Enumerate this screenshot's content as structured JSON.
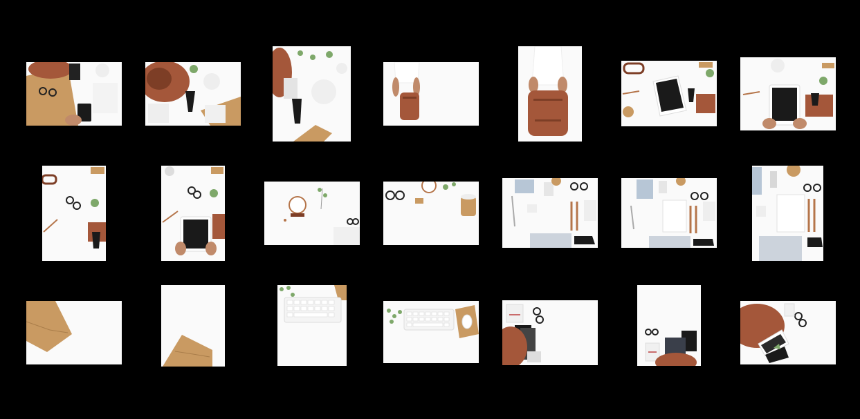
{
  "background_color": "#000000",
  "gallery": {
    "rows": [
      {
        "items": [
          {
            "subject": "leather-bag-phone-glasses"
          },
          {
            "subject": "leather-bag-tassel-notebook"
          },
          {
            "subject": "leather-bag-tassel-flowers"
          },
          {
            "subject": "woman-holding-backpack-wide"
          },
          {
            "subject": "woman-holding-backpack-tall"
          },
          {
            "subject": "tablet-wallet-flatlay"
          },
          {
            "subject": "hands-holding-tablet"
          }
        ]
      },
      {
        "items": [
          {
            "subject": "desk-glasses-pencils"
          },
          {
            "subject": "hands-holding-tablet-tall"
          },
          {
            "subject": "clock-flowers-glasses"
          },
          {
            "subject": "glasses-clock-coffee"
          },
          {
            "subject": "stationery-flatlay-laptop"
          },
          {
            "subject": "stationery-flatlay-notebook"
          },
          {
            "subject": "stationery-flatlay-tall"
          }
        ]
      },
      {
        "items": [
          {
            "subject": "kraft-envelope-wide"
          },
          {
            "subject": "kraft-envelope-tall"
          },
          {
            "subject": "keyboard-tall"
          },
          {
            "subject": "keyboard-mouse-wide"
          },
          {
            "subject": "bag-books-glasses"
          },
          {
            "subject": "bag-notebooks-tall"
          },
          {
            "subject": "bag-tablet-glasses"
          }
        ]
      }
    ]
  },
  "colors": {
    "leather": "#a4573a",
    "leather_dark": "#7d3e26",
    "kraft": "#c99a62",
    "screen": "#1a1a1a",
    "skin": "#c08a6a",
    "plant": "#7ea86a",
    "paper_gray": "#eeeeee",
    "blue_notebook": "#b7c6d6"
  }
}
